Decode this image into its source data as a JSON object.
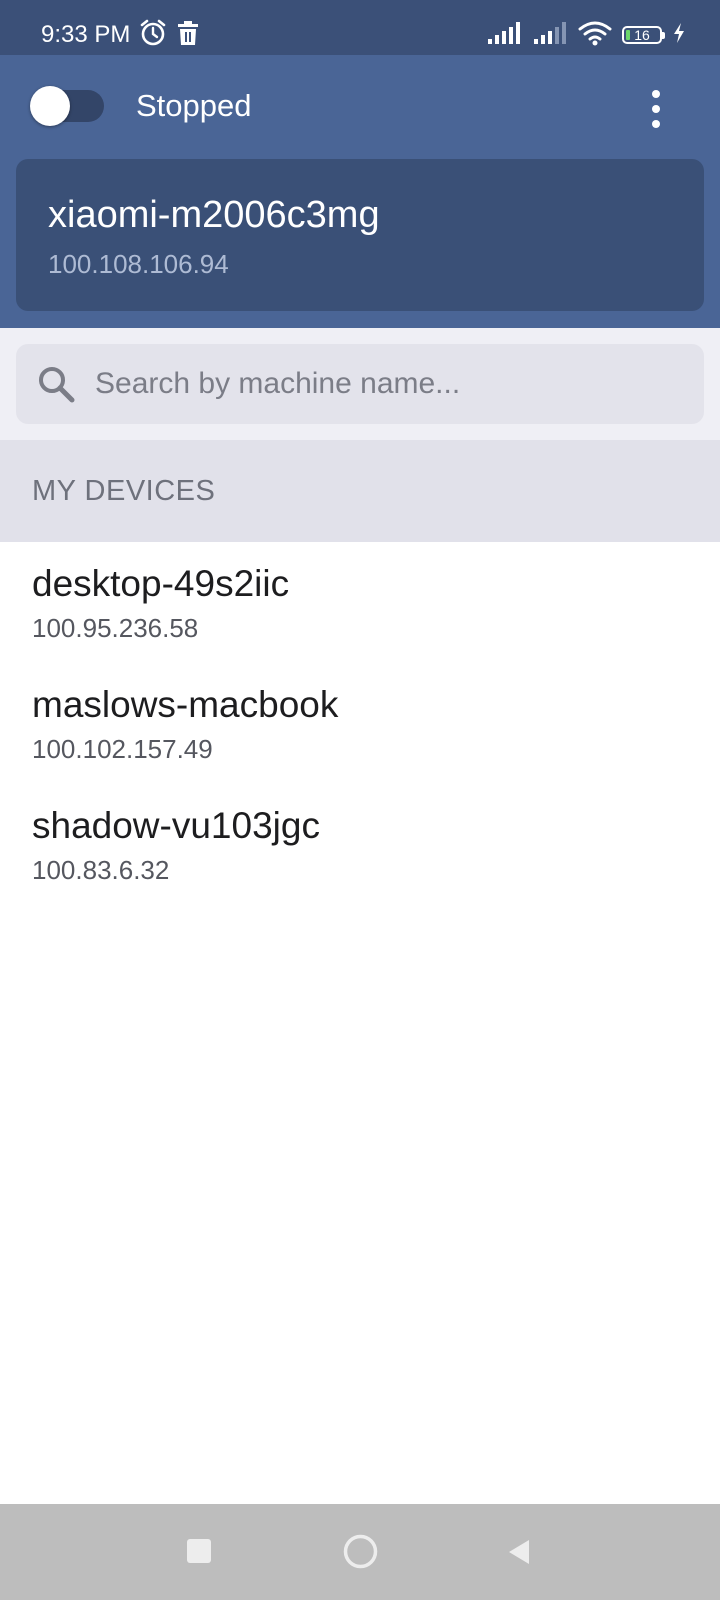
{
  "status_bar": {
    "time": "9:33 PM",
    "battery": "16",
    "left_icons": [
      "alarm-icon",
      "trash-icon"
    ],
    "right_icons": [
      "signal-icon",
      "signal-icon",
      "wifi-icon",
      "battery-icon",
      "charging-icon"
    ]
  },
  "header": {
    "toggle_on": false,
    "status": "Stopped",
    "more_icon": "more-vertical-icon",
    "current_device": {
      "name": "xiaomi-m2006c3mg",
      "ip": "100.108.106.94"
    }
  },
  "search": {
    "placeholder": "Search by machine name...",
    "value": ""
  },
  "section": {
    "title": "MY DEVICES"
  },
  "devices": [
    {
      "name": "desktop-49s2iic",
      "ip": "100.95.236.58"
    },
    {
      "name": "maslows-macbook",
      "ip": "100.102.157.49"
    },
    {
      "name": "shadow-vu103jgc",
      "ip": "100.83.6.32"
    }
  ],
  "nav_bar": {
    "icons": [
      "recents-icon",
      "home-icon",
      "back-icon"
    ]
  },
  "colors": {
    "status_bar": "#3b5078",
    "header": "#4a6596",
    "card": "#3a5077",
    "search_section": "#efeff5",
    "section_header": "#e1e1ea",
    "nav_bar": "#bdbdbd"
  }
}
